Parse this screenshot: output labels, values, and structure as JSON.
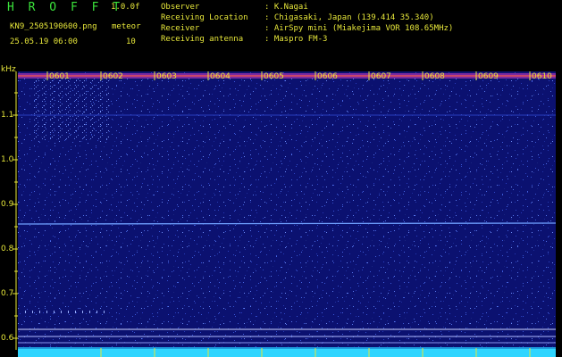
{
  "header": {
    "app_title": "H R O F F T",
    "version": "1.0.0f",
    "filename": "KN9_2505190600.png",
    "datetime": "25.05.19 06:00",
    "meteor_label": "meteor",
    "meteor_count": "10"
  },
  "info": [
    {
      "label": "Observer",
      "value": ": K.Nagai"
    },
    {
      "label": "Receiving Location",
      "value": ": Chigasaki, Japan (139.414 35.340)"
    },
    {
      "label": "Receiver",
      "value": ": AirSpy mini (Miakejima VOR 108.65MHz)"
    },
    {
      "label": "Receiving antenna",
      "value": ": Maspro FM-3"
    }
  ],
  "axis": {
    "y_unit": "kHz",
    "y_ticks": [
      "1.1",
      "1.0",
      "0.9",
      "0.8",
      "0.7",
      "0.6"
    ],
    "x_ticks": [
      "0601",
      "0602",
      "0603",
      "0604",
      "0605",
      "0606",
      "0607",
      "0608",
      "0609",
      "0610"
    ]
  },
  "colors": {
    "background": "#000000",
    "spectrum_base": "#0a0f6e",
    "text": "#e6e63a",
    "title": "#3be23b",
    "signal_line": "#6fa0ff",
    "noise_floor": "#2fd5ff"
  }
}
